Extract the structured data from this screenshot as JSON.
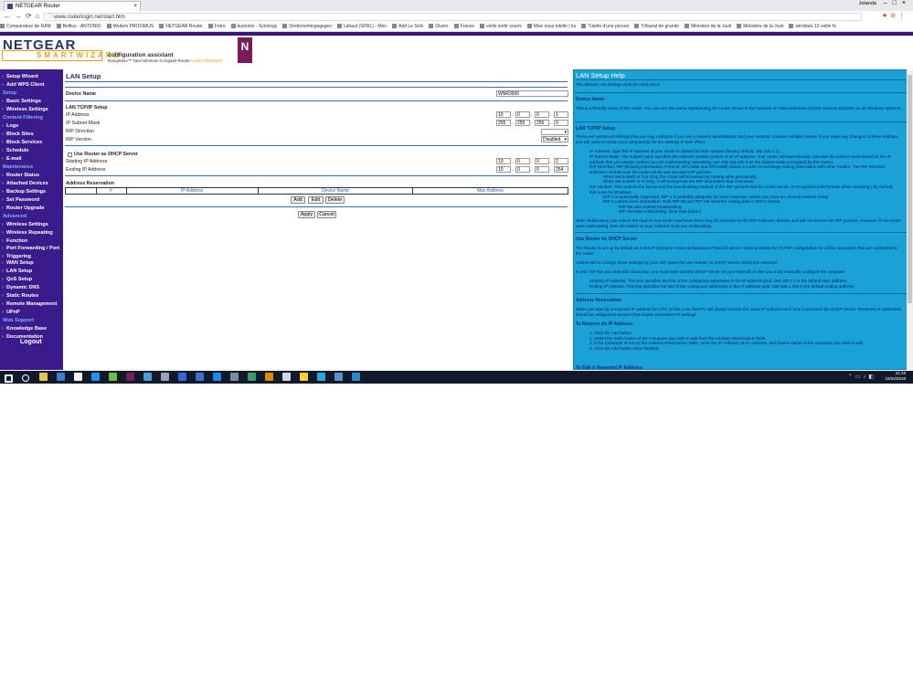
{
  "browser": {
    "tab_title": "NETGEAR Router",
    "profile": "Jolanda",
    "url": "www.routerlogin.net/start.htm",
    "bookmarks": [
      "Comparateur de RAM",
      "Belfius - ANTONIO",
      "Modem PROXIMUS",
      "NETGEAR Router",
      "Fotro",
      "bustonio - Synology",
      "Ondernemingsgegev",
      "Lahaut (SPRL) - Mon",
      "Add Le Solo",
      "Divers",
      "France",
      "veille sortir souris",
      "Mise sous tutelle | ku",
      "Tutelle d'une person",
      "Tribunal de grande",
      "Ministère de la Justi",
      "Ministère de la Justi",
      "windows 10 veille fo"
    ]
  },
  "header": {
    "logo_main": "NETGEAR",
    "logo_sub": "SMARTWIZARD",
    "subtitle": "configuration assistant",
    "product": "RangeMax™ Next Wireless N Gigabit Router",
    "model": "model WNR3500",
    "badge": "N"
  },
  "menu": {
    "items": [
      {
        "type": "item",
        "label": "Setup Wizard"
      },
      {
        "type": "item",
        "label": "Add WPS Client"
      },
      {
        "type": "head",
        "label": "Setup"
      },
      {
        "type": "item",
        "label": "Basic Settings"
      },
      {
        "type": "item",
        "label": "Wireless Settings"
      },
      {
        "type": "head",
        "label": "Content Filtering"
      },
      {
        "type": "item",
        "label": "Logs"
      },
      {
        "type": "item",
        "label": "Block Sites"
      },
      {
        "type": "item",
        "label": "Block Services"
      },
      {
        "type": "item",
        "label": "Schedule"
      },
      {
        "type": "item",
        "label": "E-mail"
      },
      {
        "type": "head",
        "label": "Maintenance"
      },
      {
        "type": "item",
        "label": "Router Status"
      },
      {
        "type": "item",
        "label": "Attached Devices"
      },
      {
        "type": "item",
        "label": "Backup Settings"
      },
      {
        "type": "item",
        "label": "Set Password"
      },
      {
        "type": "item",
        "label": "Router Upgrade"
      },
      {
        "type": "head",
        "label": "Advanced"
      },
      {
        "type": "item",
        "label": "Wireless Settings"
      },
      {
        "type": "item",
        "label": "Wireless Repeating"
      },
      {
        "type": "item",
        "label": "Function"
      },
      {
        "type": "item",
        "label": "Port Forwarding / Port"
      },
      {
        "type": "item",
        "label": "Triggering"
      },
      {
        "type": "item",
        "label": "WAN Setup"
      },
      {
        "type": "item",
        "label": "LAN Setup"
      },
      {
        "type": "item",
        "label": "QoS Setup"
      },
      {
        "type": "item",
        "label": "Dynamic DNS"
      },
      {
        "type": "item",
        "label": "Static Routes"
      },
      {
        "type": "item",
        "label": "Remote Management"
      },
      {
        "type": "item",
        "label": "UPnP"
      },
      {
        "type": "head",
        "label": "Web Support"
      },
      {
        "type": "item",
        "label": "Knowledge Base"
      },
      {
        "type": "item",
        "label": "Documentation"
      }
    ],
    "logout": "Logout"
  },
  "lan": {
    "title": "LAN Setup",
    "device_name_label": "Device Name",
    "device_name": "WNR3500",
    "tcpip_label": "LAN TCP/IP Setup",
    "ip_label": "IP Address",
    "ip": [
      "10",
      "0",
      "0",
      "1"
    ],
    "mask_label": "IP Subnet Mask",
    "mask": [
      "255",
      "255",
      "255",
      "0"
    ],
    "rip_dir_label": "RIP Direction",
    "rip_dir": "",
    "rip_ver_label": "RIP Version",
    "rip_ver": "Disabled",
    "dhcp_label": "Use Router as DHCP Server",
    "start_label": "Starting IP Address",
    "start_ip": [
      "10",
      "0",
      "0",
      "2"
    ],
    "end_label": "Ending IP Address",
    "end_ip": [
      "10",
      "0",
      "0",
      "254"
    ],
    "reservation_label": "Address Reservation",
    "cols": [
      "#",
      "IP Address",
      "Device Name",
      "Mac Address"
    ],
    "add": "Add",
    "edit": "Edit",
    "delete": "Delete",
    "apply": "Apply",
    "cancel": "Cancel"
  },
  "help": {
    "title": "LAN Setup Help",
    "intro": "The default LAN settings work for most users.",
    "h_device": "Device Name",
    "t_device": "This is a friendly name of this router. You can see this name representing the router shown in the Network on Vista Windows and the Network Explorer on all Windows systems.",
    "h_tcpip": "LAN TCP/IP Setup",
    "t_tcpip": "These are advanced settings that you may configure if you are a network administrator and your network contains multiple routers. If you make any changes to these settings you will need to restart your computer(s) for the settings to take effect.",
    "b_ip": "IP Address: Type the IP address of your router in dotted decimal notation (factory default: 192.168.1.1).",
    "b_mask": "IP Subnet Mask: The subnet mask specifies the network number portion of an IP address. Your router will automatically calculate the subnet mask based on the IP address that you assign. Unless you are implementing subnetting, use 255.255.255.0 as the subnet mask (computed by the router).",
    "b_ripdir": "RIP Direction: RIP (Routing Information Protocol, RFC1058 and RFC1388) allows a router to exchange routing information with other routers. The RIP Direction selection controls how the router sends and receives RIP packets.",
    "b_ripdir1": "When set to Both or Out Only, the router will broadcast its routing table periodically.",
    "b_ripdir2": "When set to Both or In Only, it will incorporate the RIP information that it receives.",
    "b_ripver": "RIP Version: This controls the format and the broadcasting method of the RIP packets that the router sends. (It recognizes both formats when receiving.) By default, this is set for Disabled.",
    "b_ripver1": "RIP-1 is universally supported. RIP-1 is probably adequate for most networks, unless you have an unusual network setup.",
    "b_ripver2": "RIP-2 carries more information. Both RIP-2B and RIP-2M send the routing data in RIP-2 format.",
    "b_ripver2a": "RIP-2B uses subnet broadcasting.",
    "b_ripver2b": "RIP-2M uses multicasting. (See note below.)",
    "note": "Note: Multicasting can reduce the load on non-router machines since they do not listen to the RIP multicast address and will not receive the RIP packets. However, if one router uses multicasting, then all routers on your network must use multicasting.",
    "h_dhcp": "Use Router As DHCP Server",
    "t_dhcp1": "The Router is set up by default as a DHCP (Dynamic Host Configuration Protocol) server, which provides the TCP/IP configuration for all the computers that are connected to the router.",
    "t_dhcp2": "Unless told to change these settings by your ISP, leave the Use Router As DHCP Server check box selected.",
    "t_dhcp3": "If your ISP has you clear this check box, you must have another DHCP server on your network or else you must manually configure the computer.",
    "b_start": "Starting IP Address: This box specifies the first of the contiguous addresses in the IP address pool. 192.168.1.2 is the default start address.",
    "b_end": "Ending IP Address: This box specifies the last of the contiguous addresses in the IP address pool. 192.168.1.254 is the default ending address.",
    "h_res": "Address Reservation",
    "t_res": "When you specify a reserved IP address for a PC on the LAN, that PC will always receive the same IP address each time it accesses the DHCP server. Reserved IP addresses should be assigned to servers that require permanent IP settings.",
    "h_reserve": "To Reserve An IP Address:",
    "s1": "1. Click the Add button.",
    "s2": "2. Select the radio button of the Computer you wish to add from the Address Reservation Table.",
    "s3": "3. If the Computer is not on the Address Reservation Table, enter the IP Address, MAC Address, and Device Name of the computer you wish to add.",
    "s4": "4. Click the Add button when finished.",
    "h_edit": "To Edit A Reserved IP Address:"
  },
  "taskbar": {
    "time": "21:18",
    "date": "15/02/2018"
  }
}
